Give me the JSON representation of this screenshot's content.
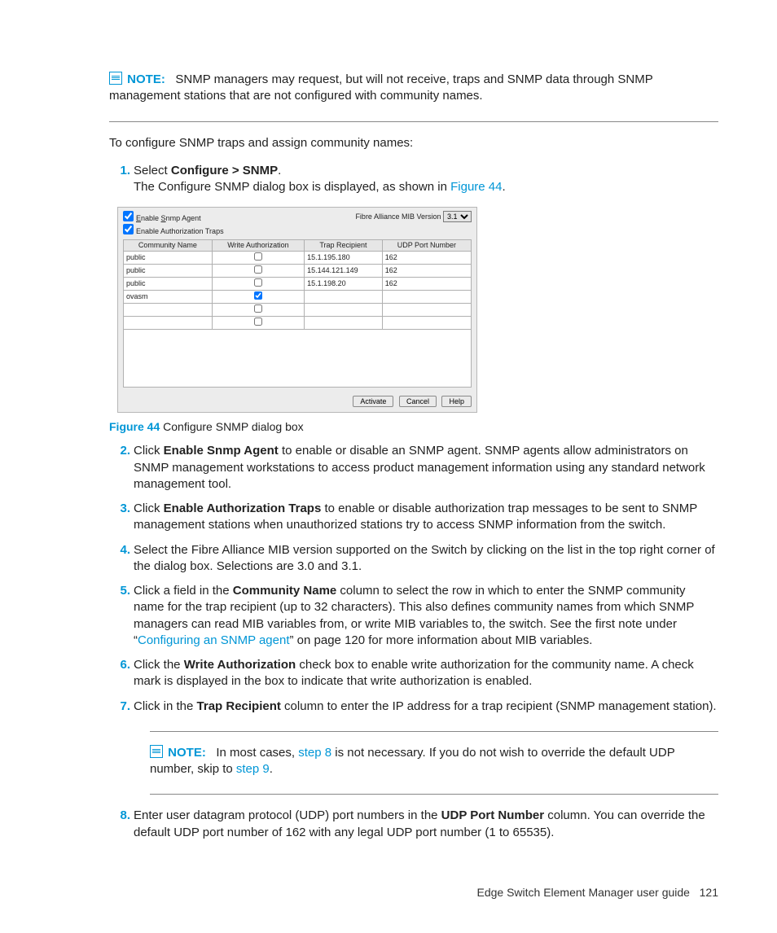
{
  "note1": {
    "label": "NOTE:",
    "text": "SNMP managers may request, but will not receive, traps and SNMP data through SNMP management stations that are not configured with community names."
  },
  "intro": "To configure SNMP traps and assign community names:",
  "steps": {
    "s1_a": "Select ",
    "s1_b": "Configure > SNMP",
    "s1_c": ".",
    "s1_line2a": "The Configure SNMP dialog box is displayed, as shown in ",
    "s1_link": "Figure 44",
    "s1_line2b": "."
  },
  "figure": {
    "num": "Figure 44",
    "caption": " Configure SNMP dialog box"
  },
  "dialog": {
    "enable_agent": "Enable Snmp Agent",
    "enable_traps": "Enable Authorization Traps",
    "mib_label": "Fibre Alliance MIB Version",
    "mib_value": "3.1",
    "headers": {
      "c1": "Community Name",
      "c2": "Write Authorization",
      "c3": "Trap Recipient",
      "c4": "UDP Port Number"
    },
    "rows": [
      {
        "name": "public",
        "write": false,
        "trap": "15.1.195.180",
        "udp": "162"
      },
      {
        "name": "public",
        "write": false,
        "trap": "15.144.121.149",
        "udp": "162"
      },
      {
        "name": "public",
        "write": false,
        "trap": "15.1.198.20",
        "udp": "162"
      },
      {
        "name": "ovasm",
        "write": true,
        "trap": "",
        "udp": ""
      },
      {
        "name": "",
        "write": false,
        "trap": "",
        "udp": ""
      },
      {
        "name": "",
        "write": false,
        "trap": "",
        "udp": ""
      }
    ],
    "buttons": {
      "activate": "Activate",
      "cancel": "Cancel",
      "help": "Help"
    }
  },
  "s2_a": "Click ",
  "s2_b": "Enable Snmp Agent",
  "s2_c": " to enable or disable an SNMP agent. SNMP agents allow administrators on SNMP management workstations to access product management information using any standard network management tool.",
  "s3_a": "Click ",
  "s3_b": "Enable Authorization Traps",
  "s3_c": " to enable or disable authorization trap messages to be sent to SNMP management stations when unauthorized stations try to access SNMP information from the switch.",
  "s4": "Select the Fibre Alliance MIB version supported on the Switch by clicking on the list in the top right corner of the dialog box. Selections are 3.0 and 3.1.",
  "s5_a": "Click a field in the ",
  "s5_b": "Community Name",
  "s5_c": " column to select the row in which to enter the SNMP community name for the trap recipient (up to 32 characters). This also defines community names from which SNMP managers can read MIB variables from, or write MIB variables to, the switch. See the first note under “",
  "s5_link": "Configuring an SNMP agent",
  "s5_d": "” on page 120 for more information about MIB variables.",
  "s6_a": "Click the ",
  "s6_b": "Write Authorization",
  "s6_c": " check box to enable write authorization for the community name. A check mark is displayed in the box to indicate that write authorization is enabled.",
  "s7_a": "Click in the ",
  "s7_b": "Trap Recipient",
  "s7_c": " column to enter the IP address for a trap recipient (SNMP management station).",
  "note2": {
    "label": "NOTE:",
    "a": "In most cases, ",
    "link1": "step 8",
    "b": " is not necessary. If you do not wish to override the default UDP number, skip to ",
    "link2": "step 9",
    "c": "."
  },
  "s8_a": "Enter user datagram protocol (UDP) port numbers in the ",
  "s8_b": "UDP Port Number",
  "s8_c": " column. You can override the default UDP port number of 162 with any legal UDP port number (1 to 65535).",
  "footer": {
    "title": "Edge Switch Element Manager user guide",
    "page": "121"
  }
}
